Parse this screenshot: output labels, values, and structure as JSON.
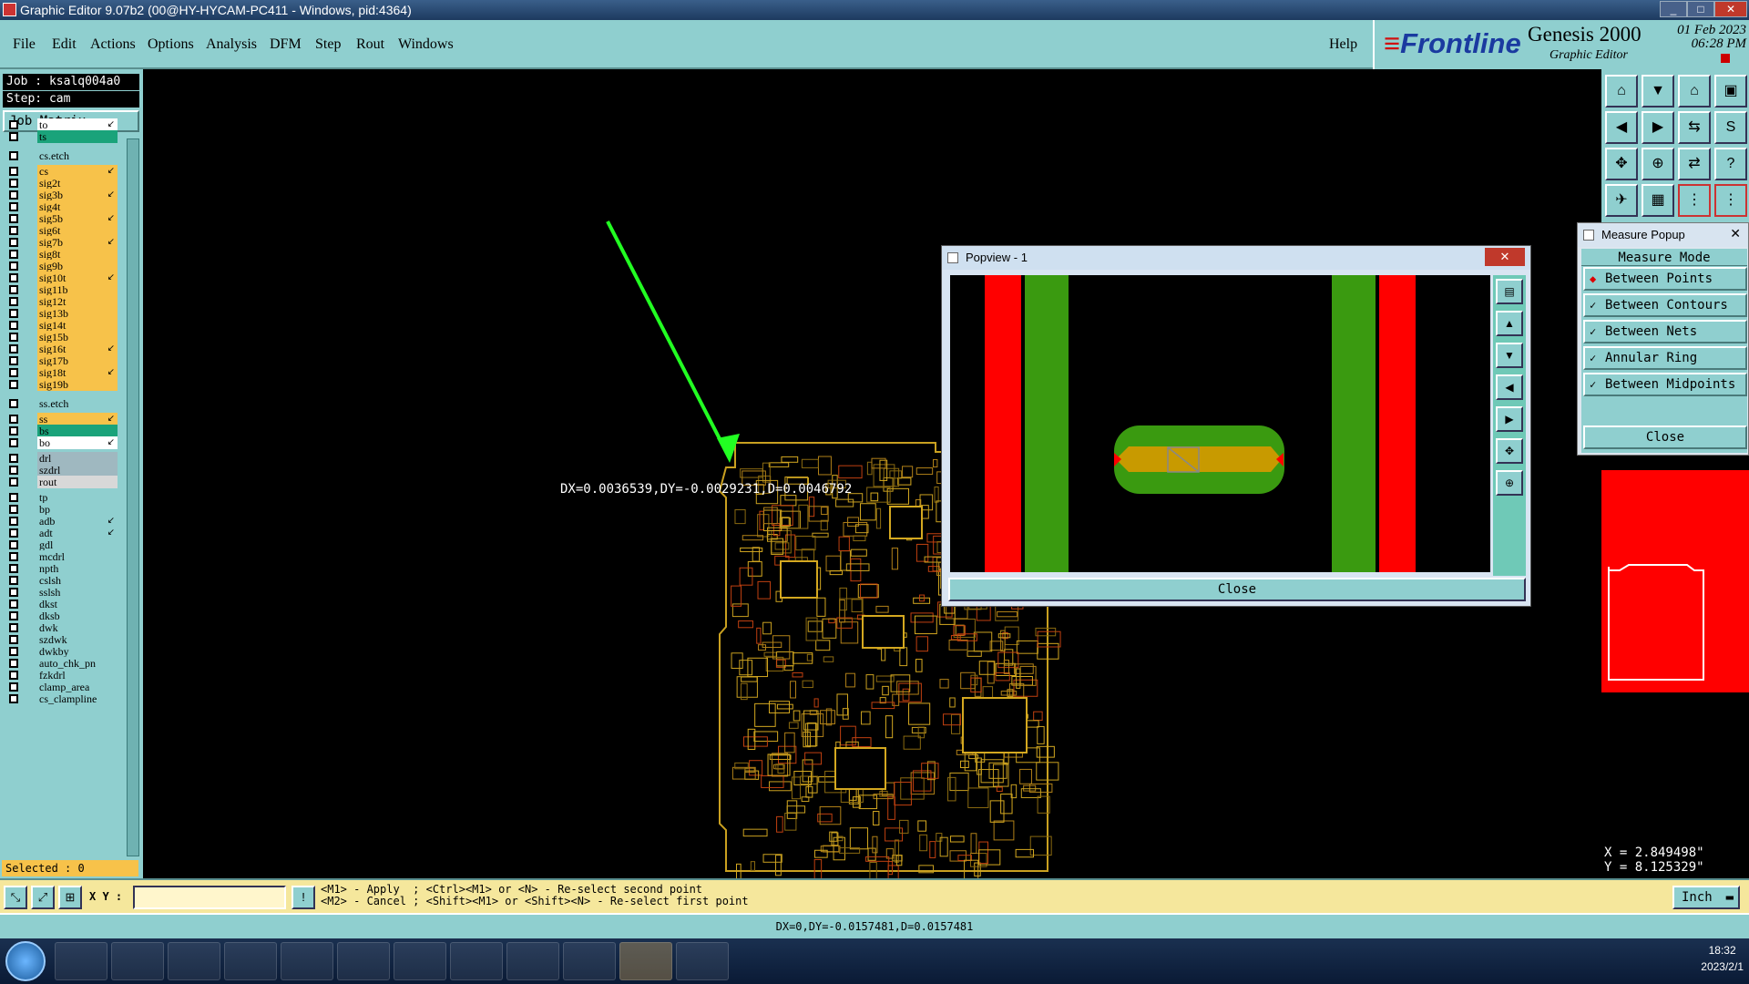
{
  "window": {
    "title": "Graphic Editor 9.07b2 (00@HY-HYCAM-PC411 - Windows, pid:4364)"
  },
  "menu": [
    "File",
    "Edit",
    "Actions",
    "Options",
    "Analysis",
    "DFM",
    "Step",
    "Rout",
    "Windows"
  ],
  "help_label": "Help",
  "brand": {
    "logo_prefix": "Front",
    "logo_suffix": "line",
    "product": "Genesis 2000",
    "product_sub": "Graphic Editor",
    "date": "01 Feb 2023",
    "time": "06:28 PM"
  },
  "job": {
    "job_label": "Job : ksalq004a0",
    "step_label": "Step: cam",
    "matrix_button": "Job Matrix ..."
  },
  "layers": [
    {
      "name": "to",
      "color": "#ffffff"
    },
    {
      "name": "ts",
      "color": "#1aa37a"
    },
    {
      "name": "cs.etch",
      "color": "#8fcfcf"
    },
    {
      "name": "cs",
      "color": "#f7c24a"
    },
    {
      "name": "sig2t",
      "color": "#f7c24a"
    },
    {
      "name": "sig3b",
      "color": "#f7c24a"
    },
    {
      "name": "sig4t",
      "color": "#f7c24a"
    },
    {
      "name": "sig5b",
      "color": "#f7c24a"
    },
    {
      "name": "sig6t",
      "color": "#f7c24a"
    },
    {
      "name": "sig7b",
      "color": "#f7c24a"
    },
    {
      "name": "sig8t",
      "color": "#f7c24a"
    },
    {
      "name": "sig9b",
      "color": "#f7c24a"
    },
    {
      "name": "sig10t",
      "color": "#f7c24a"
    },
    {
      "name": "sig11b",
      "color": "#f7c24a"
    },
    {
      "name": "sig12t",
      "color": "#f7c24a"
    },
    {
      "name": "sig13b",
      "color": "#f7c24a"
    },
    {
      "name": "sig14t",
      "color": "#f7c24a"
    },
    {
      "name": "sig15b",
      "color": "#f7c24a"
    },
    {
      "name": "sig16t",
      "color": "#f7c24a"
    },
    {
      "name": "sig17b",
      "color": "#f7c24a"
    },
    {
      "name": "sig18t",
      "color": "#f7c24a"
    },
    {
      "name": "sig19b",
      "color": "#f7c24a"
    },
    {
      "name": "ss.etch",
      "color": "#8fcfcf"
    },
    {
      "name": "ss",
      "color": "#f7c24a"
    },
    {
      "name": "bs",
      "color": "#1aa37a"
    },
    {
      "name": "bo",
      "color": "#ffffff"
    },
    {
      "name": "drl",
      "color": "#9fb8c0"
    },
    {
      "name": "szdrl",
      "color": "#9fb8c0"
    },
    {
      "name": "rout",
      "color": "#d8d8d8"
    },
    {
      "name": "tp",
      "color": "#8fcfcf"
    },
    {
      "name": "bp",
      "color": "#8fcfcf"
    },
    {
      "name": "adb",
      "color": "#8fcfcf"
    },
    {
      "name": "adt",
      "color": "#8fcfcf"
    },
    {
      "name": "gdl",
      "color": "#8fcfcf"
    },
    {
      "name": "mcdrl",
      "color": "#8fcfcf"
    },
    {
      "name": "npth",
      "color": "#8fcfcf"
    },
    {
      "name": "cslsh",
      "color": "#8fcfcf"
    },
    {
      "name": "sslsh",
      "color": "#8fcfcf"
    },
    {
      "name": "dkst",
      "color": "#8fcfcf"
    },
    {
      "name": "dksb",
      "color": "#8fcfcf"
    },
    {
      "name": "dwk",
      "color": "#8fcfcf"
    },
    {
      "name": "szdwk",
      "color": "#8fcfcf"
    },
    {
      "name": "dwkby",
      "color": "#8fcfcf"
    },
    {
      "name": "auto_chk_pn",
      "color": "#8fcfcf"
    },
    {
      "name": "fzkdrl",
      "color": "#8fcfcf"
    },
    {
      "name": "clamp_area",
      "color": "#8fcfcf"
    },
    {
      "name": "cs_clampline",
      "color": "#8fcfcf"
    }
  ],
  "selected_label": "Selected : 0",
  "canvas": {
    "measure_text": "DX=0.0036539,DY=-0.0029231,D=0.0046792"
  },
  "popview": {
    "title": "Popview - 1",
    "close_label": "Close"
  },
  "measure": {
    "title": "Measure Popup",
    "mode_label": "Measure Mode",
    "options": [
      "Between Points",
      "Between Contours",
      "Between Nets",
      "Annular Ring",
      "Between Midpoints"
    ],
    "close_label": "Close"
  },
  "coords": {
    "x": "X = 2.849498\"",
    "y": "Y = 8.125329\""
  },
  "bottom": {
    "xy_label": "X Y :",
    "hint1": "<M1> - Apply  ; <Ctrl><M1> or <N> - Re-select second point",
    "hint2": "<M2> - Cancel ; <Shift><M1> or <Shift><N> - Re-select first point",
    "unit": "Inch"
  },
  "status": "DX=0,DY=-0.0157481,D=0.0157481",
  "taskbar": {
    "time": "18:32",
    "date": "2023/2/1"
  }
}
